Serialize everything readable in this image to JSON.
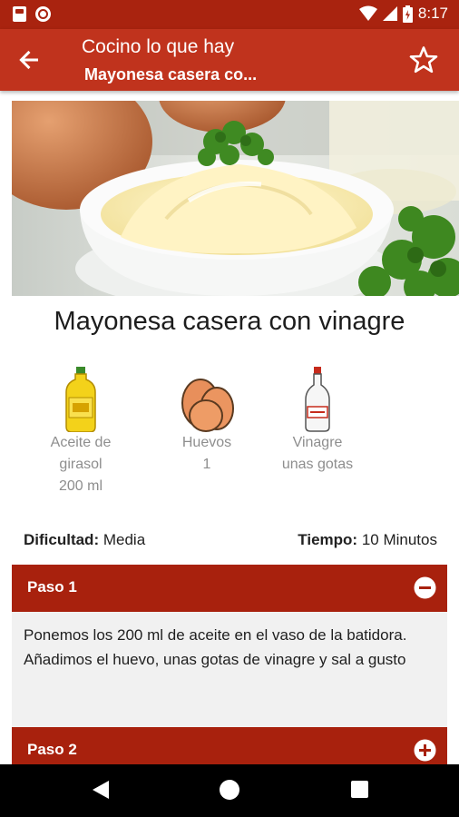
{
  "status_bar": {
    "time": "8:17"
  },
  "app_bar": {
    "title": "Cocino lo que hay",
    "subtitle": "Mayonesa casera co..."
  },
  "recipe": {
    "title": "Mayonesa casera con vinagre",
    "ingredients": [
      {
        "name_line1": "Aceite de",
        "name_line2": "girasol",
        "qty": "200 ml",
        "icon": "oil-bottle-icon"
      },
      {
        "name_line1": "Huevos",
        "qty": "1",
        "icon": "eggs-icon"
      },
      {
        "name_line1": "Vinagre",
        "qty": "unas gotas",
        "icon": "vinegar-bottle-icon"
      }
    ],
    "difficulty_label": "Dificultad:",
    "difficulty_value": "Media",
    "time_label": "Tiempo:",
    "time_value": "10 Minutos"
  },
  "steps": [
    {
      "label": "Paso 1",
      "expanded": true,
      "text": "Ponemos los 200 ml de aceite en el vaso de la batidora. Añadimos el huevo, unas gotas de vinagre y sal a gusto"
    },
    {
      "label": "Paso 2",
      "expanded": false
    }
  ],
  "colors": {
    "status_bar": "#a9230f",
    "app_bar": "#c0331d",
    "step_header": "#a8210d"
  }
}
